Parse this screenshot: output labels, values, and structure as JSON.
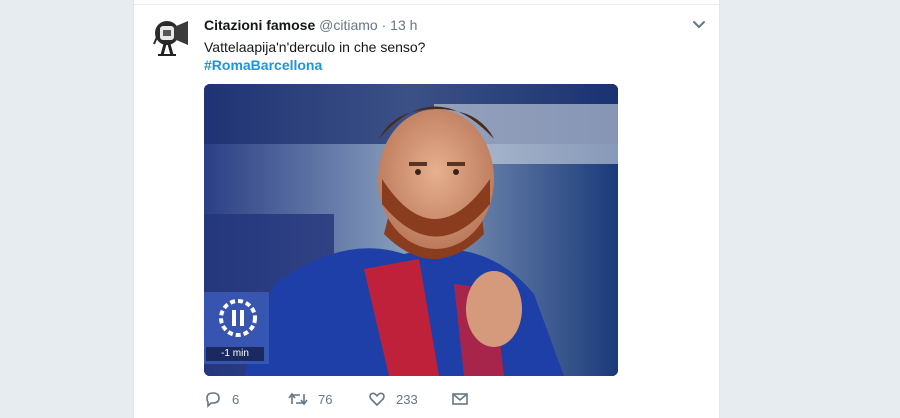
{
  "tweet": {
    "author_name": "Citazioni famose",
    "handle": "@citiamo",
    "separator": "·",
    "time": "13 h",
    "text": "Vattelaapija'n'derculo in che senso?",
    "hashtag": "#RomaBarcellona",
    "media": {
      "scoreboard_time": "-1 min"
    },
    "actions": {
      "replies": "6",
      "retweets": "76",
      "likes": "233"
    }
  },
  "icons": {
    "avatar": "megaphone-avatar-icon",
    "caret": "chevron-down-icon",
    "reply": "reply-icon",
    "retweet": "retweet-icon",
    "like": "heart-icon",
    "message": "envelope-icon",
    "pause": "pause-icon"
  },
  "colors": {
    "background": "#e6ecf0",
    "card": "#ffffff",
    "name": "#14171a",
    "secondary": "#657786",
    "hashtag": "#1b95e0",
    "jersey_blue": "#1e3fa8",
    "jersey_red": "#c0213a",
    "beard": "#8a3c1e"
  }
}
